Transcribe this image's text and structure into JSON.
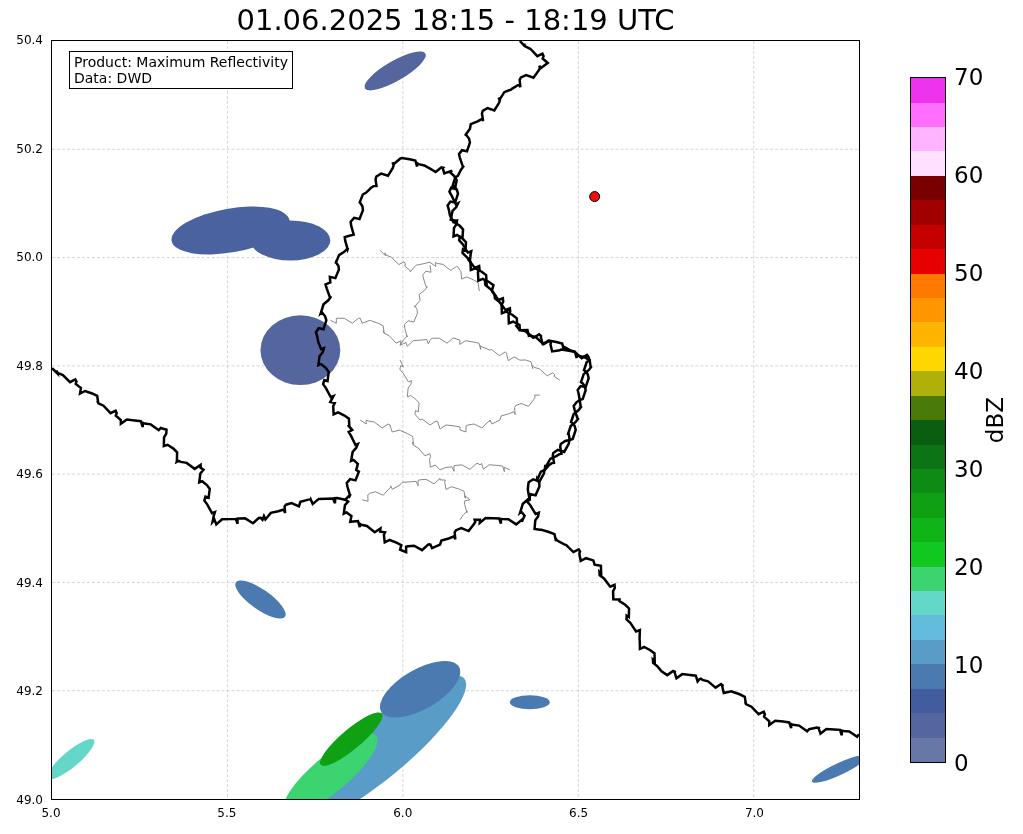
{
  "title": "01.06.2025 18:15 - 18:19 UTC",
  "legend_box": [
    "Product: Maximum Reflectivity",
    "Data: DWD"
  ],
  "map": {
    "xticks": [
      "5.0",
      "5.5",
      "6.0",
      "6.5",
      "7.0"
    ],
    "yticks": [
      "50.4",
      "50.2",
      "50.0",
      "49.8",
      "49.6",
      "49.4",
      "49.2",
      "49.0"
    ]
  },
  "colorbar": {
    "label": "dBZ",
    "ticks": [
      "70",
      "60",
      "50",
      "40",
      "30",
      "20",
      "10",
      "0"
    ],
    "bins": [
      {
        "color": "#6677a8"
      },
      {
        "color": "#55669e"
      },
      {
        "color": "#425c9e"
      },
      {
        "color": "#4a7ab0"
      },
      {
        "color": "#5a9cc8"
      },
      {
        "color": "#64bcdc"
      },
      {
        "color": "#64d8c8"
      },
      {
        "color": "#3cd470"
      },
      {
        "color": "#10c820"
      },
      {
        "color": "#0eb418"
      },
      {
        "color": "#10a014"
      },
      {
        "color": "#0c8c14"
      },
      {
        "color": "#0c7414"
      },
      {
        "color": "#0a5e10"
      },
      {
        "color": "#4a7a0a"
      },
      {
        "color": "#b0b00a"
      },
      {
        "color": "#ffd700"
      },
      {
        "color": "#ffb400"
      },
      {
        "color": "#ff9600"
      },
      {
        "color": "#ff7800"
      },
      {
        "color": "#e60000"
      },
      {
        "color": "#c40000"
      },
      {
        "color": "#a00000"
      },
      {
        "color": "#780000"
      },
      {
        "color": "#ffe0ff"
      },
      {
        "color": "#ffb4ff"
      },
      {
        "color": "#ff6eff"
      },
      {
        "color": "#ee33ee"
      }
    ]
  }
}
